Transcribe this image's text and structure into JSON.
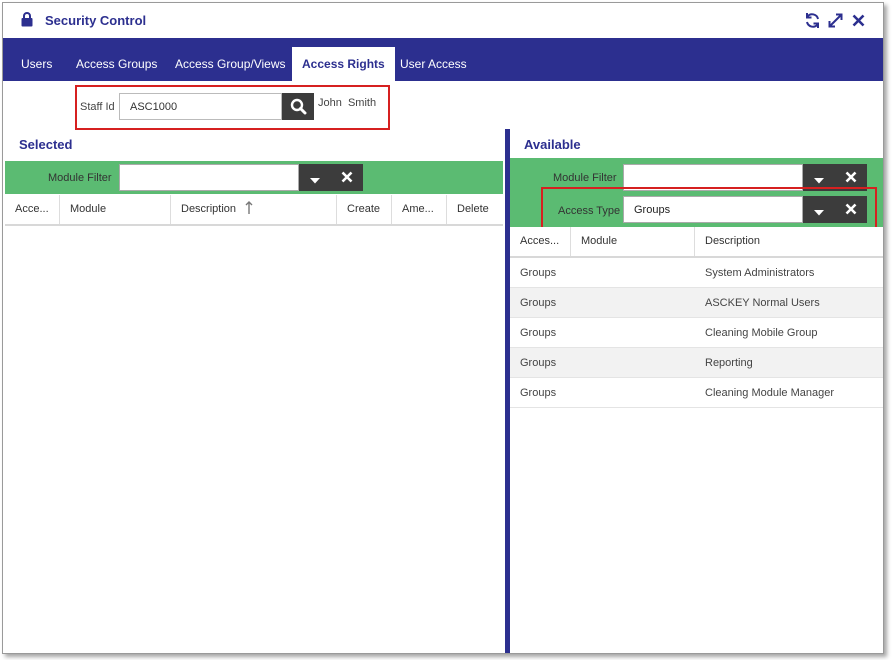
{
  "window": {
    "title": "Security Control",
    "icons": {
      "title": "lock-icon",
      "refresh": "refresh-icon",
      "maximize": "expand-icon",
      "close": "close-icon"
    }
  },
  "tabs": [
    {
      "label": "Users",
      "active": false
    },
    {
      "label": "Access Groups",
      "active": false
    },
    {
      "label": "Access Group/Views",
      "active": false
    },
    {
      "label": "Access Rights",
      "active": true
    },
    {
      "label": "User Access",
      "active": false
    }
  ],
  "staff": {
    "label": "Staff Id",
    "value": "ASC1000",
    "name": "John  Smith"
  },
  "selected": {
    "title": "Selected",
    "module_filter_label": "Module Filter",
    "module_filter_value": "",
    "columns": [
      "Acce...",
      "Module",
      "Description",
      "Create",
      "Ame...",
      "Delete"
    ],
    "sort_column": "Description",
    "rows": []
  },
  "available": {
    "title": "Available",
    "module_filter_label": "Module Filter",
    "module_filter_value": "",
    "access_type_label": "Access Type",
    "access_type_value": "Groups",
    "columns": [
      "Acces...",
      "Module",
      "Description"
    ],
    "rows": [
      {
        "access": "Groups",
        "module": "",
        "description": "System Administrators"
      },
      {
        "access": "Groups",
        "module": "",
        "description": "ASCKEY Normal Users"
      },
      {
        "access": "Groups",
        "module": "",
        "description": "Cleaning Mobile Group"
      },
      {
        "access": "Groups",
        "module": "",
        "description": "Reporting"
      },
      {
        "access": "Groups",
        "module": "",
        "description": "Cleaning Module Manager"
      }
    ]
  },
  "colors": {
    "primary": "#2c2f8f",
    "filter_bar": "#5bbb72",
    "button": "#3c3c3c",
    "highlight": "#d62020"
  }
}
